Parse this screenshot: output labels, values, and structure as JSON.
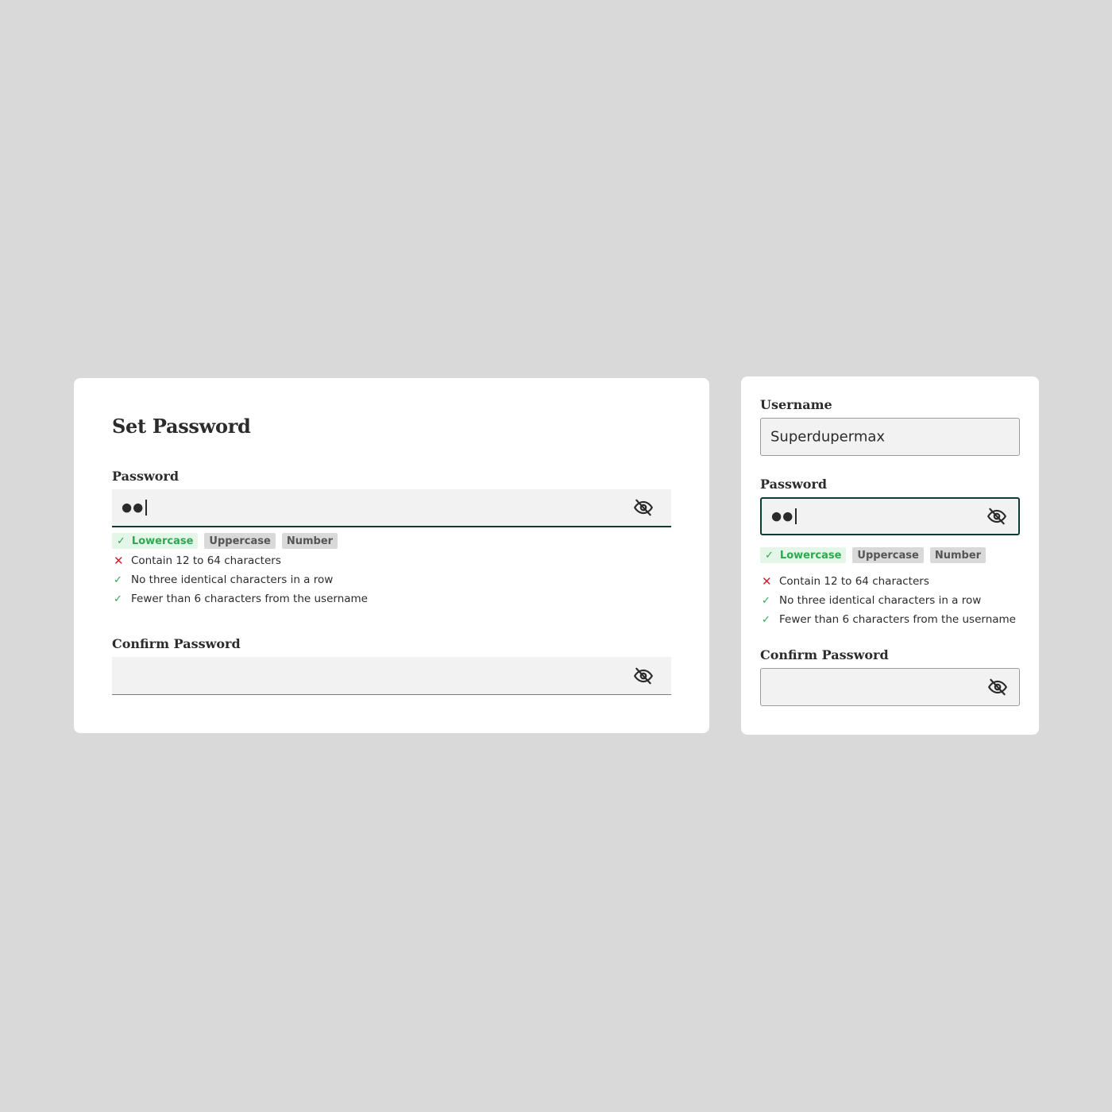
{
  "left_form": {
    "title": "Set Password",
    "password": {
      "label": "Password",
      "value": "●●",
      "visibility_icon": "eye-slash-icon"
    },
    "tags": [
      {
        "label": "Lowercase",
        "met": true
      },
      {
        "label": "Uppercase",
        "met": false
      },
      {
        "label": "Number",
        "met": false
      }
    ],
    "rules": [
      {
        "text": "Contain 12 to 64 characters",
        "met": false
      },
      {
        "text": "No three identical characters in a row",
        "met": true
      },
      {
        "text": "Fewer than 6 characters from the username",
        "met": true
      }
    ],
    "confirm": {
      "label": "Confirm Password",
      "value": "",
      "visibility_icon": "eye-slash-icon"
    }
  },
  "right_form": {
    "username": {
      "label": "Username",
      "value": "Superdupermax"
    },
    "password": {
      "label": "Password",
      "value": "●●",
      "visibility_icon": "eye-slash-icon"
    },
    "tags": [
      {
        "label": "Lowercase",
        "met": true
      },
      {
        "label": "Uppercase",
        "met": false
      },
      {
        "label": "Number",
        "met": false
      }
    ],
    "rules": [
      {
        "text": "Contain 12 to 64 characters",
        "met": false
      },
      {
        "text": "No three identical characters in a row",
        "met": true
      },
      {
        "text": "Fewer than 6 characters from the username",
        "met": true
      }
    ],
    "confirm": {
      "label": "Confirm Password",
      "value": "",
      "visibility_icon": "eye-slash-icon"
    }
  },
  "colors": {
    "page_background": "#d9d9d9",
    "field_background": "#f2f2f2",
    "focus_border": "#0f3b36",
    "pass": "#2fa84f",
    "pass_tag_bg": "#e3f6e8",
    "fail": "#d0202e",
    "neutral_tag_bg": "#d9d9d9"
  }
}
